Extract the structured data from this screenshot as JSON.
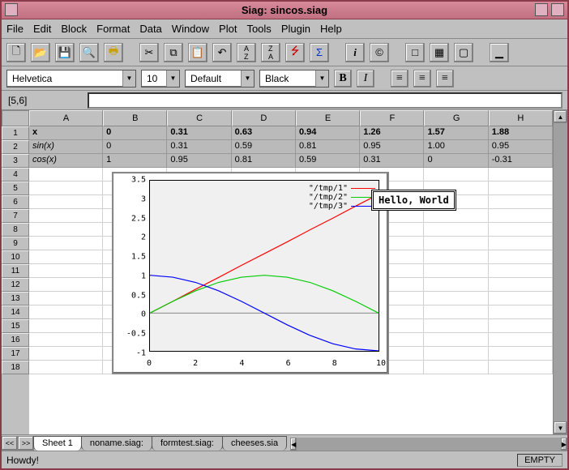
{
  "window": {
    "title": "Siag: sincos.siag"
  },
  "menu": [
    "File",
    "Edit",
    "Block",
    "Format",
    "Data",
    "Window",
    "Plot",
    "Tools",
    "Plugin",
    "Help"
  ],
  "format": {
    "font": "Helvetica",
    "size": "10",
    "style": "Default",
    "color": "Black"
  },
  "cellref": "[5,6]",
  "columns": [
    "A",
    "B",
    "C",
    "D",
    "E",
    "F",
    "G",
    "H"
  ],
  "rowcount": 18,
  "data_rows": [
    {
      "label": "x",
      "vals": [
        "0",
        "0.31",
        "0.63",
        "0.94",
        "1.26",
        "1.57",
        "1.88"
      ],
      "bold": true
    },
    {
      "label": "sin(x)",
      "vals": [
        "0",
        "0.31",
        "0.59",
        "0.81",
        "0.95",
        "1.00",
        "0.95"
      ],
      "ital": true
    },
    {
      "label": "cos(x)",
      "vals": [
        "1",
        "0.95",
        "0.81",
        "0.59",
        "0.31",
        "0",
        "-0.31"
      ],
      "ital": true
    }
  ],
  "tabs": {
    "nav": [
      "<<",
      ">>"
    ],
    "items": [
      "Sheet 1",
      "noname.siag:",
      "formtest.siag:",
      "cheeses.sia"
    ],
    "active": 0
  },
  "status": {
    "left": "Howdy!",
    "right": "EMPTY"
  },
  "float_label": "Hello, World",
  "chart_data": {
    "type": "line",
    "xlim": [
      0,
      10
    ],
    "ylim": [
      -1,
      3.5
    ],
    "yticks": [
      -1,
      -0.5,
      0,
      0.5,
      1,
      1.5,
      2,
      2.5,
      3,
      3.5
    ],
    "xticks": [
      0,
      2,
      4,
      6,
      8,
      10
    ],
    "series": [
      {
        "name": "\"/tmp/1\"",
        "color": "#ff0000",
        "x": [
          0,
          1,
          2,
          3,
          4,
          5,
          6,
          7,
          8,
          9,
          10
        ],
        "y": [
          0,
          0.31,
          0.63,
          0.94,
          1.26,
          1.57,
          1.88,
          2.2,
          2.51,
          2.83,
          3.14
        ]
      },
      {
        "name": "\"/tmp/2\"",
        "color": "#00cc00",
        "x": [
          0,
          1,
          2,
          3,
          4,
          5,
          6,
          7,
          8,
          9,
          10
        ],
        "y": [
          0,
          0.31,
          0.59,
          0.81,
          0.95,
          1.0,
          0.95,
          0.81,
          0.59,
          0.31,
          0
        ]
      },
      {
        "name": "\"/tmp/3\"",
        "color": "#0000ff",
        "x": [
          0,
          1,
          2,
          3,
          4,
          5,
          6,
          7,
          8,
          9,
          10
        ],
        "y": [
          1,
          0.95,
          0.81,
          0.59,
          0.31,
          0,
          -0.31,
          -0.59,
          -0.81,
          -0.95,
          -1
        ]
      }
    ]
  }
}
